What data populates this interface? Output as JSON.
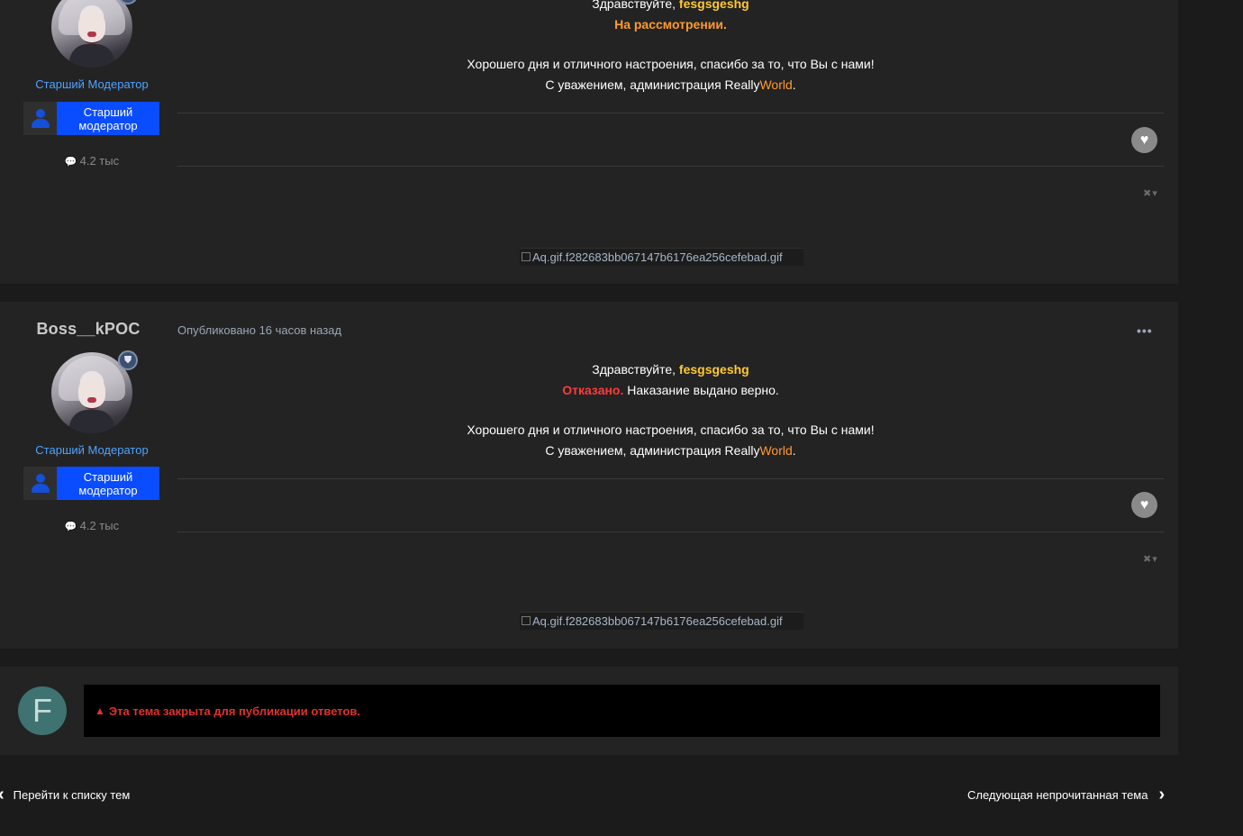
{
  "colors": {
    "page_bg": "#1b1b1b",
    "post_bg": "#232323",
    "role_blue": "#4ea3ff",
    "group_blue": "#0a4cff",
    "username_yellow": "#ffc930",
    "status_orange": "#ff9a2e",
    "status_red": "#ff3b3b",
    "closed_red": "#e0322d"
  },
  "post1": {
    "author": {
      "role": "Старший Модератор",
      "group_label": "Старший модератор",
      "posts_count": "4.2 тыс"
    },
    "content": {
      "greeting": "Здравствуйте,",
      "username": "fesgsgeshg",
      "status": "На рассмотрении.",
      "status_tail": "",
      "wishes": "Хорошего дня и отличного настроения, спасибо за то, что Вы с нами!",
      "regards_prefix": "С уважением, администрация Really",
      "brand_world": "World",
      "regards_suffix": "."
    },
    "signature_alt": "Aq.gif.f282683bb067147b6176ea256cefebad.gif"
  },
  "post2": {
    "author": {
      "name": "Boss__kPOC",
      "role": "Старший Модератор",
      "group_label": "Старший модератор",
      "posts_count": "4.2 тыс"
    },
    "meta": "Опубликовано 16 часов назад",
    "content": {
      "greeting": "Здравствуйте,",
      "username": "fesgsgeshg",
      "status": "Отказано.",
      "status_tail": "Наказание выдано верно.",
      "wishes": "Хорошего дня и отличного настроения, спасибо за то, что Вы с нами!",
      "regards_prefix": "С уважением, администрация Really",
      "brand_world": "World",
      "regards_suffix": "."
    },
    "signature_alt": "Aq.gif.f282683bb067147b6176ea256cefebad.gif"
  },
  "closed": {
    "avatar_letter": "F",
    "message": "Эта тема закрыта для публикации ответов."
  },
  "navigation": {
    "prev_label": "Перейти к списку тем",
    "next_label": "Следующая непрочитанная тема"
  },
  "icons": {
    "like": "heart-icon",
    "comment": "comment-icon",
    "more": "ellipsis-icon",
    "warning": "warning-icon",
    "mod": "mod-tools-icon"
  }
}
